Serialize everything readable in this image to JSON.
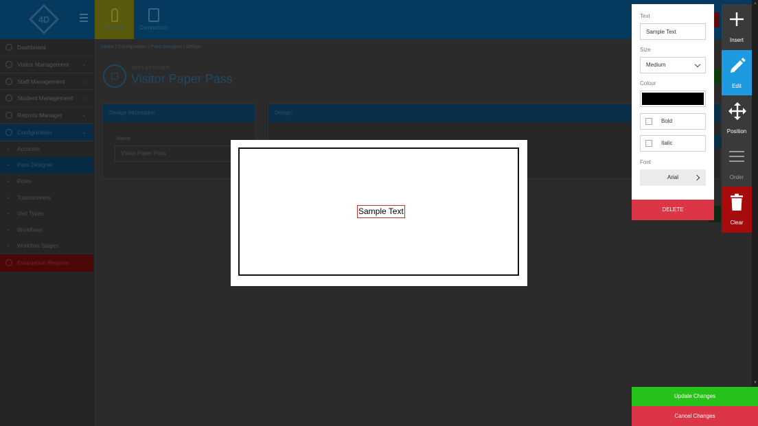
{
  "topbar": {
    "logo_text": "4D",
    "tabs": [
      {
        "label": "Visitors"
      },
      {
        "label": "Contractors"
      }
    ]
  },
  "sidebar": {
    "items": [
      {
        "label": "Dashboard",
        "icon": "dashboard-icon"
      },
      {
        "label": "Visitor Management",
        "icon": "user-icon",
        "expandable": true
      },
      {
        "label": "Staff Management",
        "icon": "staff-icon",
        "expandable": true
      },
      {
        "label": "Student Management",
        "icon": "student-icon",
        "expandable": true
      },
      {
        "label": "Reports Manager",
        "icon": "reports-icon",
        "expandable": true
      },
      {
        "label": "Configuration",
        "icon": "gear-icon",
        "expandable": true
      }
    ],
    "sub_items": [
      {
        "label": "Accounts"
      },
      {
        "label": "Pass Designer"
      },
      {
        "label": "Roles"
      },
      {
        "label": "Touchscreens"
      },
      {
        "label": "Visit Types"
      },
      {
        "label": "Workflows"
      },
      {
        "label": "Workflow Stages"
      }
    ],
    "evacuation": {
      "label": "Evacuation Register",
      "icon": "fire-icon"
    }
  },
  "breadcrumb": {
    "items": [
      "Visitor",
      "Configuration",
      "Pass Designer",
      "Design"
    ],
    "separator": "/"
  },
  "page": {
    "subtitle": "PASS DESIGNER",
    "title": "Visitor Paper Pass"
  },
  "panels": {
    "info_title": "Design Information",
    "name_label": "Name",
    "name_value": "Visitor Paper Pass",
    "design_title": "Design"
  },
  "canvas": {
    "sample_text": "Sample Text"
  },
  "properties": {
    "text_label": "Text",
    "text_value": "Sample Text",
    "size_label": "Size",
    "size_value": "Medium",
    "colour_label": "Colour",
    "colour_value": "#000000",
    "bold_label": "Bold",
    "bold_checked": false,
    "italic_label": "Italic",
    "italic_checked": false,
    "font_label": "Font",
    "font_value": "Arial",
    "delete_label": "DELETE"
  },
  "tools": {
    "insert": "Insert",
    "edit": "Edit",
    "position": "Position",
    "order": "Order",
    "clear": "Clear"
  },
  "actions": {
    "update": "Update Changes",
    "cancel": "Cancel Changes"
  },
  "colors": {
    "accent_blue": "#1e9be0",
    "danger_red": "#dc3545",
    "clear_red": "#a80b0b",
    "update_green": "#27c219"
  }
}
